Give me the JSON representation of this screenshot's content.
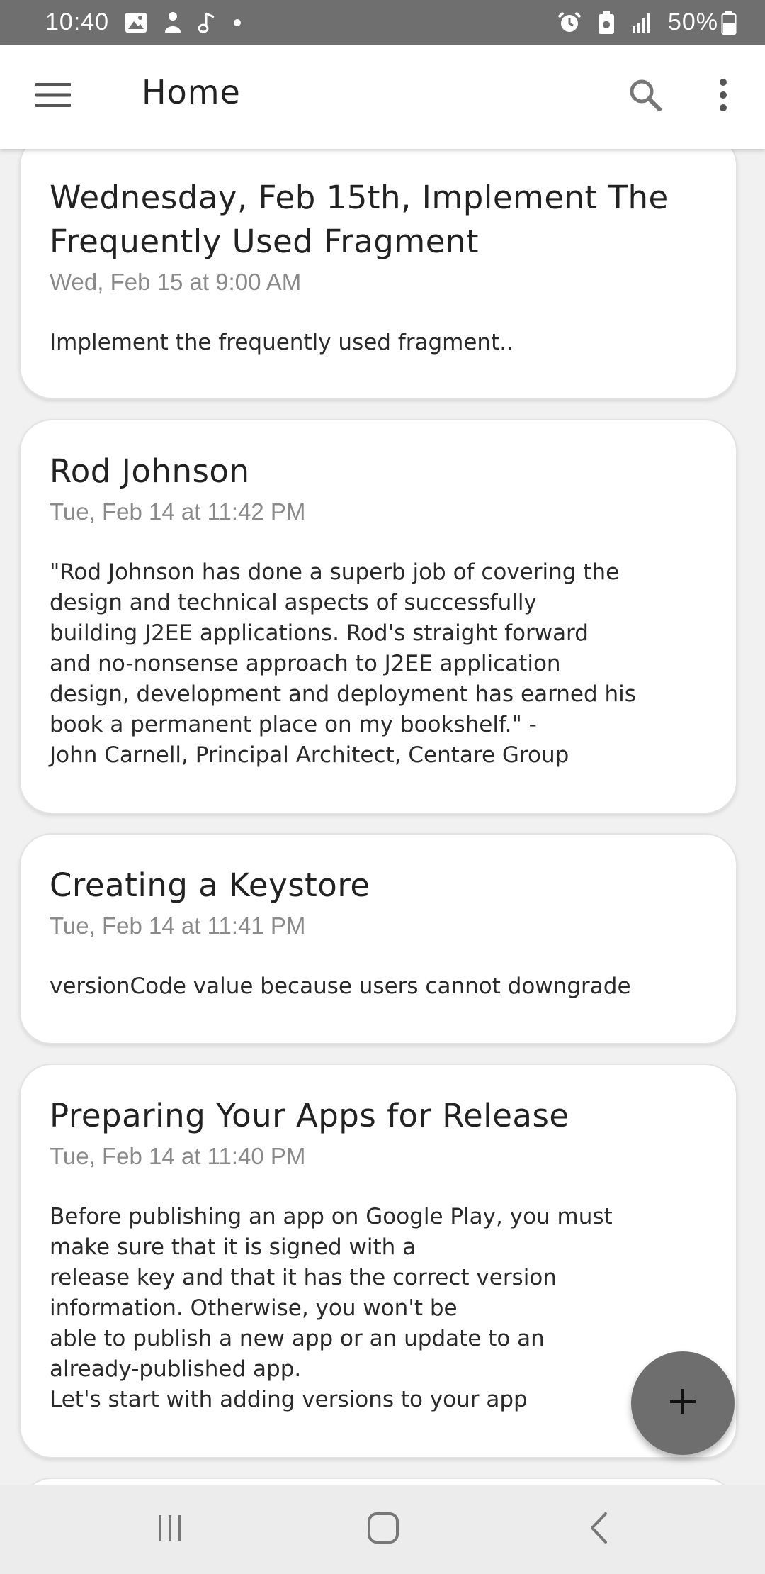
{
  "status_bar": {
    "time": "10:40",
    "battery": "50%",
    "left_icons": [
      "gallery-icon",
      "person-icon",
      "music-note-icon",
      "dot-icon"
    ],
    "right_icons": [
      "alarm-icon",
      "battery-saver-icon",
      "signal-icon",
      "battery-icon"
    ]
  },
  "app_bar": {
    "title": "Home",
    "menu_icon": "hamburger-menu-icon",
    "search_icon": "search-icon",
    "more_icon": "more-vertical-icon"
  },
  "notes": [
    {
      "title": "Wednesday, Feb 15th, Implement The Frequently Used Fragment",
      "date": "Wed, Feb 15 at 9:00 AM",
      "body": "Implement the frequently used fragment.."
    },
    {
      "title": "Rod Johnson",
      "date": "Tue, Feb 14 at 11:42 PM",
      "body": "\"Rod Johnson has done a superb job of covering the\ndesign and technical aspects of successfully\nbuilding J2EE applications. Rod's straight forward\nand no-nonsense approach to J2EE application\ndesign, development and deployment has earned his\nbook a permanent place on my bookshelf.\" -\nJohn Carnell, Principal Architect, Centare Group"
    },
    {
      "title": "Creating a Keystore",
      "date": "Tue, Feb 14 at 11:41 PM",
      "body": "versionCode value because users cannot downgrade"
    },
    {
      "title": "Preparing Your Apps for Release",
      "date": "Tue, Feb 14 at 11:40 PM",
      "body": "Before publishing an app on Google Play, you must\nmake sure that it is signed with a\nrelease key and that it has the correct version\ninformation. Otherwise, you won't be\nable to publish a new app or an update to an\nalready-published app.\nLet's start with adding versions to your app"
    }
  ],
  "fab": {
    "icon": "plus-icon"
  },
  "nav_bar": {
    "recents_icon": "recent-apps-icon",
    "home_icon": "home-icon",
    "back_icon": "back-icon"
  },
  "colors": {
    "status_bar": "#6f6f6f",
    "app_bar": "#ffffff",
    "background": "#f1f1f1",
    "fab": "#6e6e6e",
    "date_text": "#8a8a8a"
  }
}
